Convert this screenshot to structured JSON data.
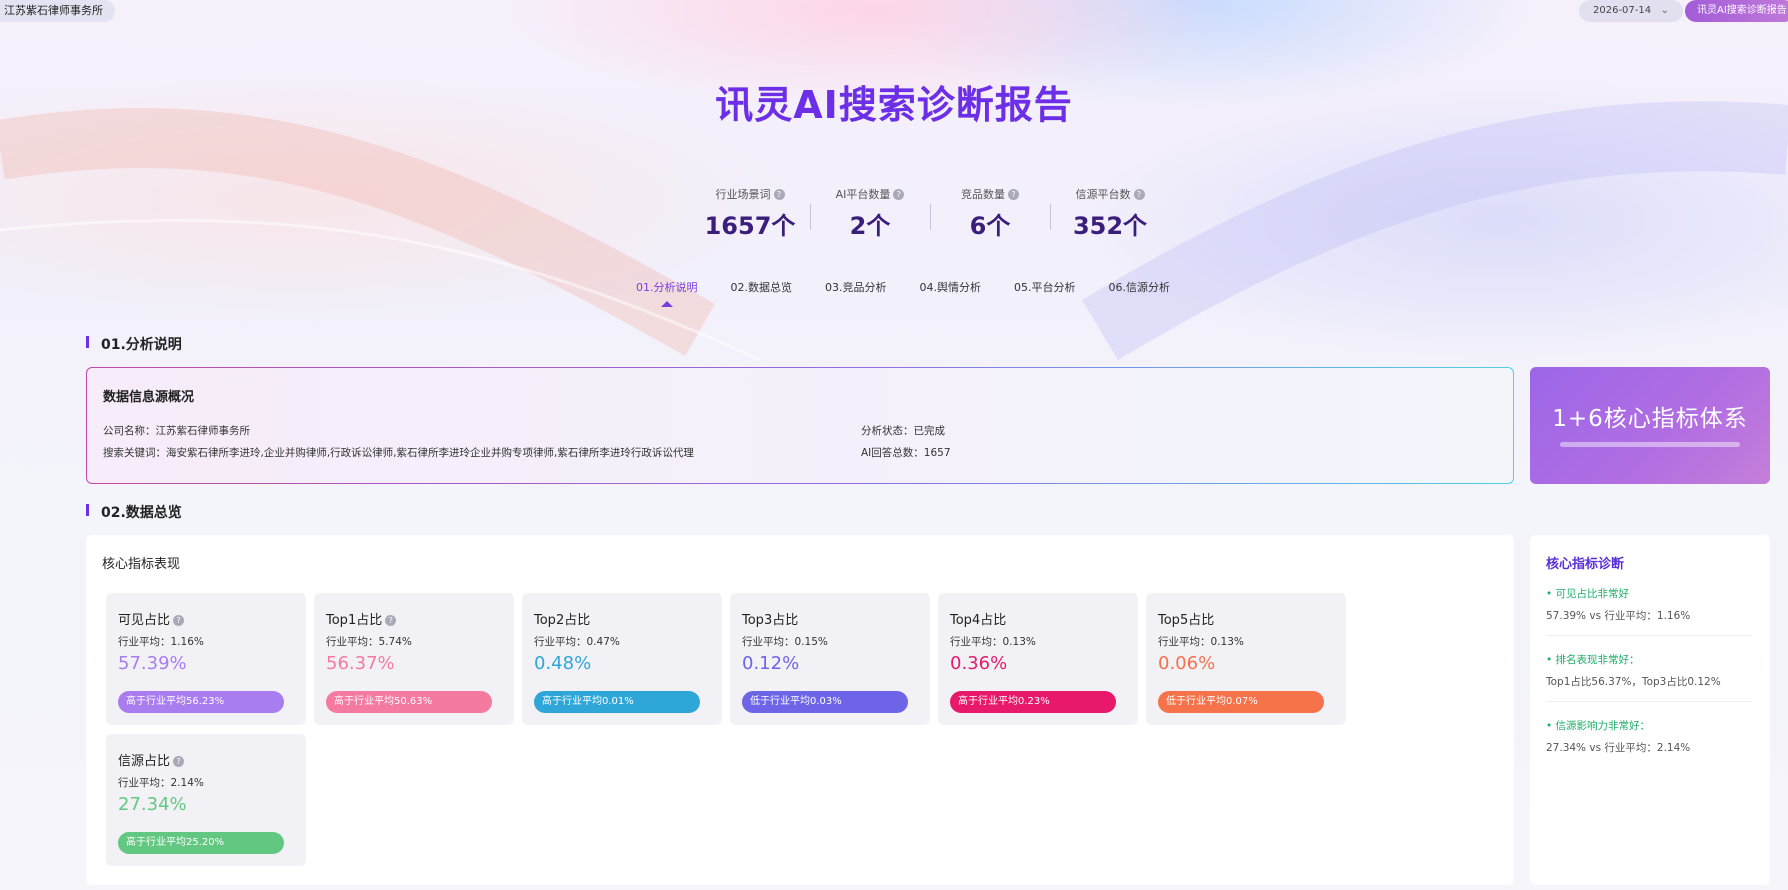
{
  "topbar": {
    "company": "江苏紫石律师事务所",
    "date": "2026-07-14",
    "report_button": "讯灵AI搜索诊断报告"
  },
  "title": "讯灵AI搜索诊断报告",
  "stats": [
    {
      "label": "行业场景词",
      "value": "1657个"
    },
    {
      "label": "AI平台数量",
      "value": "2个"
    },
    {
      "label": "竞品数量",
      "value": "6个"
    },
    {
      "label": "信源平台数",
      "value": "352个"
    }
  ],
  "tabs": [
    {
      "label": "01.分析说明",
      "active": true
    },
    {
      "label": "02.数据总览",
      "active": false
    },
    {
      "label": "03.竞品分析",
      "active": false
    },
    {
      "label": "04.舆情分析",
      "active": false
    },
    {
      "label": "05.平台分析",
      "active": false
    },
    {
      "label": "06.信源分析",
      "active": false
    }
  ],
  "section1": {
    "title": "01.分析说明",
    "card_title": "数据信息源概况",
    "company_line": "公司名称：江苏紫石律师事务所",
    "keywords_line": "搜索关键词：海安紫石律所李进玲,企业并购律师,行政诉讼律师,紫石律所李进玲企业并购专项律师,紫石律所李进玲行政诉讼代理",
    "status_line": "分析状态：已完成",
    "answers_line": "AI回答总数：1657",
    "core_system": "1+6核心指标体系"
  },
  "section2": {
    "title": "02.数据总览",
    "panel_label": "核心指标表现",
    "metrics": [
      {
        "title": "可见占比",
        "help": true,
        "avg": "行业平均：1.16%",
        "value": "57.39%",
        "badge": "高于行业平均56.23%",
        "color": "#a97cf0"
      },
      {
        "title": "Top1占比",
        "help": true,
        "avg": "行业平均：5.74%",
        "value": "56.37%",
        "badge": "高于行业平均50.63%",
        "color": "#f47aa0"
      },
      {
        "title": "Top2占比",
        "help": false,
        "avg": "行业平均：0.47%",
        "value": "0.48%",
        "badge": "高于行业平均0.01%",
        "color": "#2fa6d8"
      },
      {
        "title": "Top3占比",
        "help": false,
        "avg": "行业平均：0.15%",
        "value": "0.12%",
        "badge": "低于行业平均0.03%",
        "color": "#6d64e8"
      },
      {
        "title": "Top4占比",
        "help": false,
        "avg": "行业平均：0.13%",
        "value": "0.36%",
        "badge": "高于行业平均0.23%",
        "color": "#e8196a"
      },
      {
        "title": "Top5占比",
        "help": false,
        "avg": "行业平均：0.13%",
        "value": "0.06%",
        "badge": "低于行业平均0.07%",
        "color": "#f5724a"
      },
      {
        "title": "信源占比",
        "help": true,
        "avg": "行业平均：2.14%",
        "value": "27.34%",
        "badge": "高于行业平均25.20%",
        "color": "#62c781"
      }
    ],
    "diagnosis": {
      "title": "核心指标诊断",
      "items": [
        {
          "heading": "• 可见占比非常好",
          "detail": "57.39% vs 行业平均：1.16%"
        },
        {
          "heading": "• 排名表现非常好：",
          "detail": "Top1占比56.37%，Top3占比0.12%"
        },
        {
          "heading": "• 信源影响力非常好：",
          "detail": "27.34% vs 行业平均：2.14%"
        }
      ]
    }
  }
}
